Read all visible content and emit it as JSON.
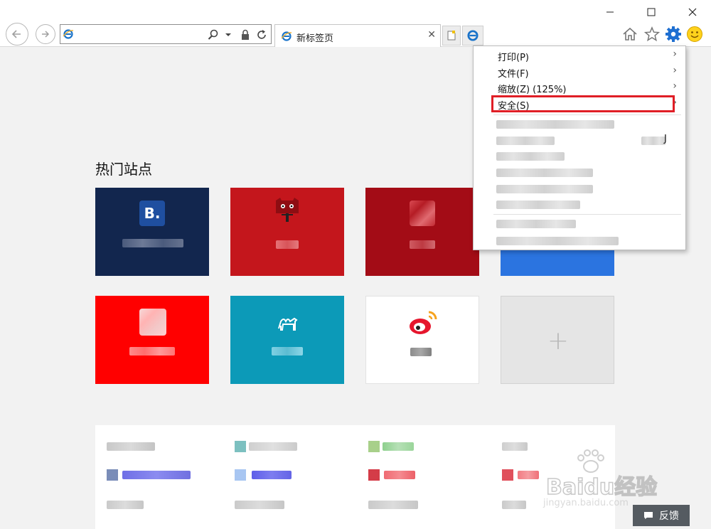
{
  "browser": {
    "address_value": "",
    "tab_title": "新标签页",
    "window_controls": {
      "minimize": "—",
      "maximize": "☐",
      "close": "✕"
    },
    "tab_close": "✕"
  },
  "content": {
    "section_title": "热门站点",
    "tiles_row1_colors": [
      "#12264e",
      "#c4161c",
      "#a30c16",
      "#2b74e0"
    ],
    "tiles_row2_colors": [
      "#ff0000",
      "#0c9ab8",
      "#ffffff",
      "#e5e5e5"
    ],
    "tile_logo_letter": "B.",
    "add_tile_symbol": "+"
  },
  "tools_menu": {
    "items": [
      {
        "label": "打印(P)",
        "has_submenu": true
      },
      {
        "label": "文件(F)",
        "has_submenu": true
      },
      {
        "label": "缩放(Z) (125%)",
        "has_submenu": true
      },
      {
        "label": "安全(S)",
        "has_submenu": true,
        "highlighted": true
      }
    ],
    "shortcut_fragment": "J",
    "highlight_color": "#e01e26"
  },
  "watermark": {
    "brand": "Baidu经验",
    "url": "jingyan.baidu.com"
  },
  "feedback": {
    "label": "反馈"
  },
  "icons": [
    "ie-icon",
    "search-icon",
    "dropdown-arrow-icon",
    "lock-icon",
    "refresh-icon",
    "new-tab-icon",
    "home-icon",
    "favorites-star-icon",
    "gear-icon",
    "smiley-icon",
    "chevron-right-icon",
    "feedback-icon"
  ]
}
